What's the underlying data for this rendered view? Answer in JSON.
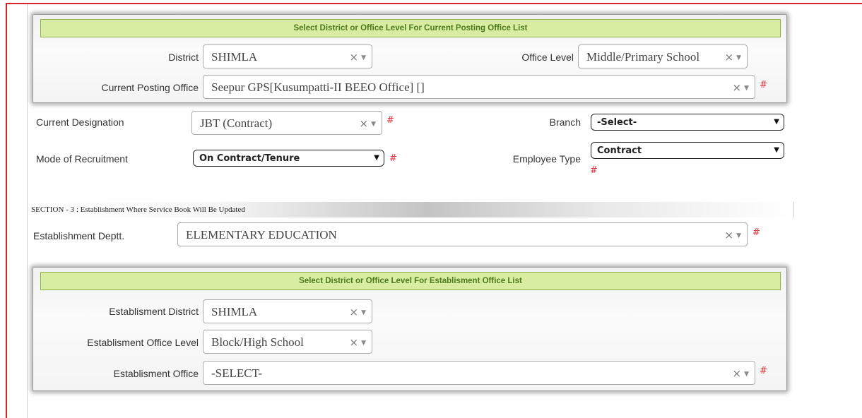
{
  "panel1": {
    "header": "Select District or Office Level For Current Posting Office List",
    "district_label": "District",
    "district_value": "SHIMLA",
    "office_level_label": "Office Level",
    "office_level_value": "Middle/Primary School",
    "posting_office_label": "Current Posting Office",
    "posting_office_value": "Seepur GPS[Kusumpatti-II BEEO Office] []"
  },
  "designation": {
    "label": "Current Designation",
    "value": "JBT (Contract)"
  },
  "branch": {
    "label": "Branch",
    "value": "-Select-"
  },
  "recruitment": {
    "label": "Mode of Recruitment",
    "value": "On Contract/Tenure"
  },
  "employee_type": {
    "label": "Employee Type",
    "value": "Contract"
  },
  "section3": {
    "title": "SECTION - 3 : Establishment Where Service Book Will Be Updated"
  },
  "est_deptt": {
    "label": "Establishment Deptt.",
    "value": "ELEMENTARY EDUCATION"
  },
  "panel2": {
    "header": "Select District or Office Level For Establisment Office List",
    "district_label": "Establisment District",
    "district_value": "SHIMLA",
    "office_level_label": "Establisment Office Level",
    "office_level_value": "Block/High School",
    "office_label": "Establisment Office",
    "office_value": "-SELECT-"
  },
  "glyphs": {
    "clear": "×",
    "dropdown": "▼",
    "required": "#"
  },
  "colors": {
    "frame": "#d9222a",
    "header_bg": "#d8eda1",
    "header_text": "#4d7a1c",
    "required": "#e0303a"
  }
}
